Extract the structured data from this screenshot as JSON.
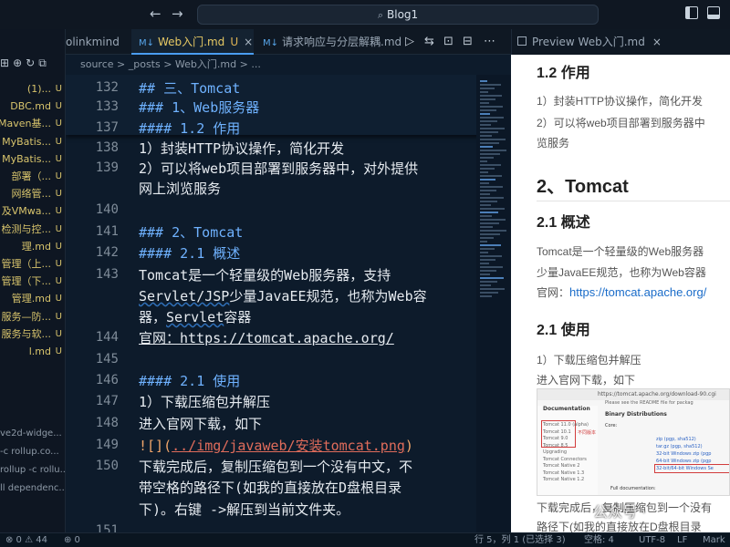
{
  "titlebar": {
    "back_glyph": "←",
    "forward_glyph": "→",
    "search_text": "Blog1"
  },
  "sidebar": {
    "actions": [
      "⊞",
      "⊕",
      "↻",
      "⧉"
    ],
    "files": [
      {
        "label": "(1)...",
        "status": "U"
      },
      {
        "label": "DBC.md",
        "status": "U"
      },
      {
        "label": "Maven基...",
        "status": "U"
      },
      {
        "label": "MyBatis...",
        "status": "U"
      },
      {
        "label": "MyBatis...",
        "status": "U"
      },
      {
        "label": "部署（...",
        "status": "U"
      },
      {
        "label": "网络管...",
        "status": "U"
      },
      {
        "label": "及VMwa...",
        "status": "U"
      },
      {
        "label": "检测与控...",
        "status": "U"
      },
      {
        "label": "理.md",
        "status": "U"
      },
      {
        "label": "管理（上...",
        "status": "U"
      },
      {
        "label": "管理（下...",
        "status": "U"
      },
      {
        "label": "管理.md",
        "status": "U"
      },
      {
        "label": "服务—防...",
        "status": "U"
      },
      {
        "label": "服务与软...",
        "status": "U"
      },
      {
        "label": "l.md",
        "status": "U"
      }
    ],
    "outline": [
      "ve2d-widge...",
      "-c rollup.co...",
      "rollup -c rollu...",
      "ll dependenc..."
    ]
  },
  "tabs": [
    {
      "label": "olinkmind",
      "active": false
    },
    {
      "label": "Web入门.md",
      "flag": "U",
      "active": true
    },
    {
      "label": "请求响应与分层解耦.md",
      "active": false
    }
  ],
  "tab_tools": [
    "▷",
    "⇆",
    "⊡",
    "⊟",
    "⋯"
  ],
  "breadcrumb": "source > _posts > Web入门.md > ...",
  "editor": {
    "lines": [
      {
        "n": "132",
        "text": "## 三、Tomcat",
        "kind": "h"
      },
      {
        "n": "133",
        "text": "### 1、Web服务器",
        "kind": "h"
      },
      {
        "n": "137",
        "text": "#### 1.2 作用",
        "kind": "h"
      },
      {
        "n": "138",
        "text": "1）封装HTTP协议操作，简化开发",
        "kind": "p"
      },
      {
        "n": "139",
        "text": "2）可以将web项目部署到服务器中，对外提供",
        "kind": "p"
      },
      {
        "n": "",
        "text": "网上浏览服务",
        "kind": "p"
      },
      {
        "n": "140",
        "text": "",
        "kind": "p"
      },
      {
        "n": "141",
        "text": "### 2、Tomcat",
        "kind": "h"
      },
      {
        "n": "142",
        "text": "#### 2.1 概述",
        "kind": "h"
      },
      {
        "n": "143",
        "text": "Tomcat是一个轻量级的Web服务器，支持",
        "kind": "p"
      },
      {
        "n": "",
        "text": "Servlet/JSP少量JavaEE规范，也称为Web容",
        "kind": "p"
      },
      {
        "n": "",
        "text": "器，Servlet容器",
        "kind": "p"
      },
      {
        "n": "144",
        "text": "官网：https://tomcat.apache.org/",
        "kind": "link"
      },
      {
        "n": "145",
        "text": "",
        "kind": "p"
      },
      {
        "n": "146",
        "text": "#### 2.1 使用",
        "kind": "h"
      },
      {
        "n": "147",
        "text": "1）下载压缩包并解压",
        "kind": "p"
      },
      {
        "n": "148",
        "text": "进入官网下载，如下",
        "kind": "p"
      },
      {
        "n": "149",
        "text": "![](../img/javaweb/安装tomcat.png)",
        "kind": "img"
      },
      {
        "n": "150",
        "text": "下载完成后，复制压缩包到一个没有中文，不",
        "kind": "p"
      },
      {
        "n": "",
        "text": "带空格的路径下(如我的直接放在D盘根目录",
        "kind": "p"
      },
      {
        "n": "",
        "text": "下)。右键 ->解压到当前文件夹。",
        "kind": "p"
      },
      {
        "n": "151",
        "text": "",
        "kind": "p"
      }
    ]
  },
  "preview": {
    "tab_label": "Preview Web入门.md",
    "h12": "1.2 作用",
    "p1": "1）封装HTTP协议操作，简化开发",
    "p2": "2）可以将web项目部署到服务器中",
    "p2b": "览服务",
    "h2": "2、Tomcat",
    "h21": "2.1 概述",
    "p3": "Tomcat是一个轻量级的Web服务器",
    "p3b": "少量JavaEE规范，也称为Web容器",
    "p4_prefix": "官网：",
    "p4_link": "https://tomcat.apache.org/",
    "h21b": "2.1 使用",
    "p5": "1）下载压缩包并解压",
    "p6": "进入官网下载，如下",
    "shot": {
      "url": "https://tomcat.apache.org/download-90.cgi",
      "left_title": "Documentation",
      "left_items": [
        "Tomcat 11.0 (alpha)",
        "Tomcat 10.1",
        "Tomcat 9.0",
        "Tomcat 8.5",
        "Upgrading",
        "Tomcat Connectors",
        "Tomcat Native 2",
        "Tomcat Native 1.3",
        "Tomcat Native 1.2"
      ],
      "red_note": "不同版本",
      "right_top": "Please see the README file for packag",
      "right_title": "Binary Distributions",
      "right_core": "Core:",
      "right_links": [
        "zip (pgp, sha512)",
        "tar.gz (pgp, sha512)",
        "32-bit Windows zip (pgp",
        "64-bit Windows zip (pgp",
        "32-bit/64-bit Windows Se"
      ],
      "full_doc": "Full documentation:"
    },
    "p7": "下载完成后，复制压缩包到一个没有",
    "p7b": "路径下(如我的直接放在D盘根目录"
  },
  "watermark": "公众号 ·",
  "statusbar": {
    "left1": "⊗ 0  ⚠ 44",
    "left2": "⊕ 0",
    "right": [
      "行 5，列 1 (已选择 3)",
      "空格: 4",
      "UTF-8",
      "LF",
      "Mark"
    ]
  }
}
